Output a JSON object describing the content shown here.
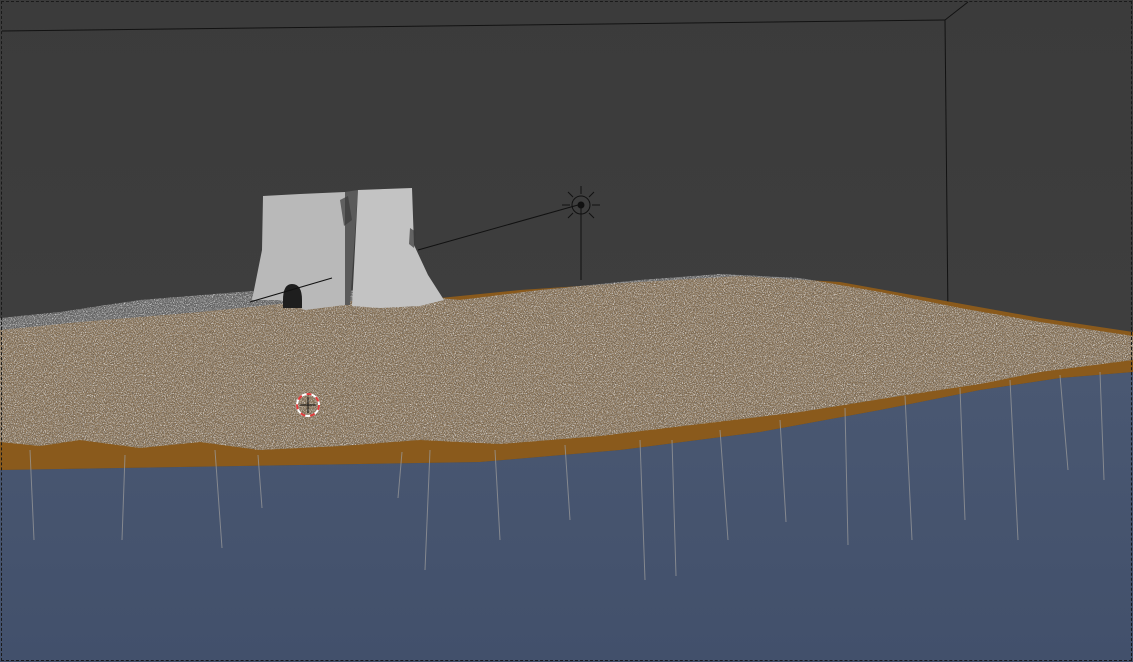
{
  "viewport": {
    "name": "3D Viewport",
    "shading": "solid",
    "background_color": "#3e3e3e"
  },
  "scene": {
    "objects": [
      {
        "name": "wall-ruin",
        "color": "#b9b9b9"
      },
      {
        "name": "terrain-ground",
        "color": "#8a5a1c"
      },
      {
        "name": "grass-particles",
        "color": "#c8c8c8"
      },
      {
        "name": "water-plane",
        "color": "#46546f"
      },
      {
        "name": "lamp-sun",
        "color": "#111111"
      },
      {
        "name": "camera-frame",
        "color": "#111111"
      }
    ],
    "cursor_3d": {
      "name": "3d-cursor",
      "colors": [
        "#e03c3c",
        "#ffffff"
      ]
    }
  }
}
